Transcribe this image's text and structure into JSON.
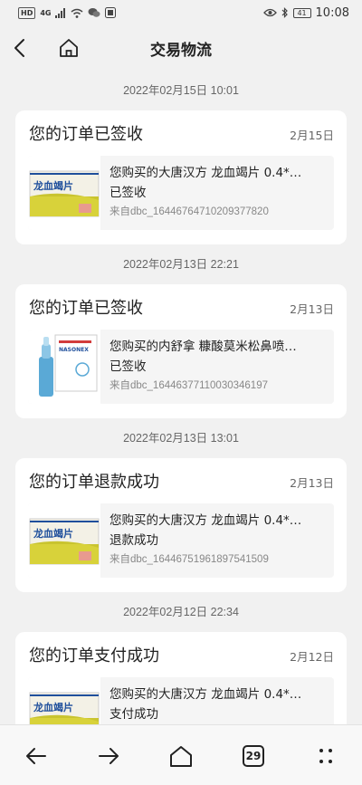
{
  "status_bar": {
    "left_chip": "HD",
    "network": "4G",
    "time": "10:08",
    "battery": "41"
  },
  "header": {
    "title": "交易物流"
  },
  "orders": [
    {
      "timestamp": "2022年02月15日 10:01",
      "title": "您的订单已签收",
      "date": "2月15日",
      "description": "您购买的大唐汉方 龙血竭片 0.4*…",
      "status": "已签收",
      "source": "来自dbc_16446764710209377820",
      "thumb": "longxuejie"
    },
    {
      "timestamp": "2022年02月13日 22:21",
      "title": "您的订单已签收",
      "date": "2月13日",
      "description": "您购买的内舒拿 糠酸莫米松鼻喷…",
      "status": "已签收",
      "source": "来自dbc_16446377110030346197",
      "thumb": "nasal"
    },
    {
      "timestamp": "2022年02月13日 13:01",
      "title": "您的订单退款成功",
      "date": "2月13日",
      "description": "您购买的大唐汉方 龙血竭片 0.4*…",
      "status": "退款成功",
      "source": "来自dbc_16446751961897541509",
      "thumb": "longxuejie"
    },
    {
      "timestamp": "2022年02月12日 22:34",
      "title": "您的订单支付成功",
      "date": "2月12日",
      "description": "您购买的大唐汉方 龙血竭片 0.4*…",
      "status": "支付成功",
      "source": "",
      "thumb": "longxuejie"
    }
  ],
  "product_labels": {
    "longxuejie_name": "龙血竭片",
    "nasal_name": "NASONEX"
  },
  "bottom_nav": {
    "tab_count": "29"
  },
  "colors": {
    "background": "#f1f1f1",
    "card": "#ffffff",
    "box_yellow": "#d8d23a",
    "box_blue": "#1f4f9c",
    "nasal_blue": "#5aa9d6"
  }
}
